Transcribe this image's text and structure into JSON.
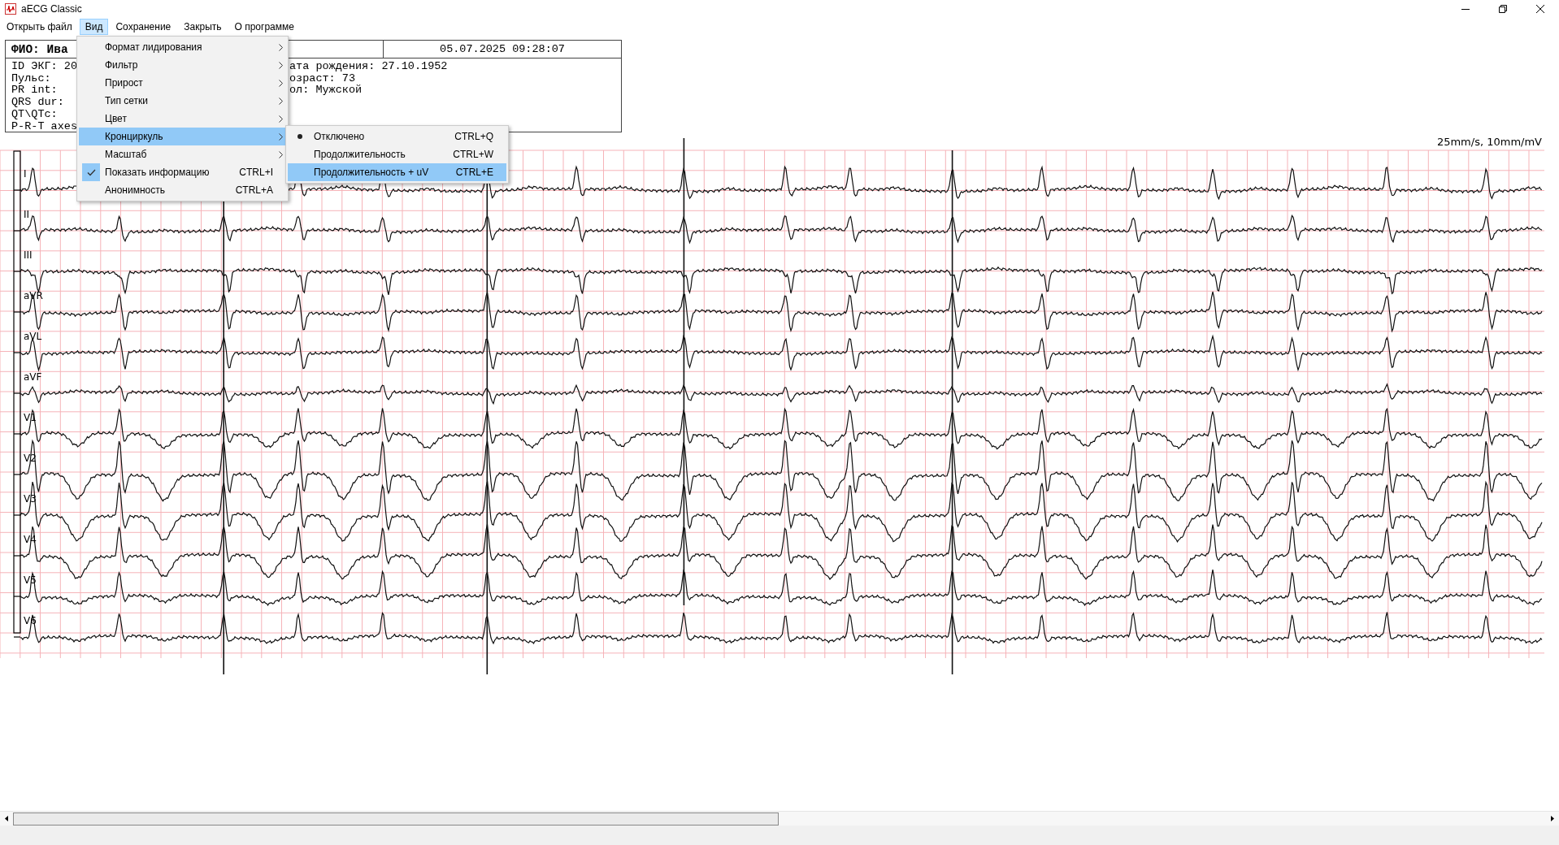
{
  "window": {
    "title": "aECG Classic"
  },
  "menu_bar": [
    {
      "label": "Открыть файл",
      "selected": false
    },
    {
      "label": "Вид",
      "selected": true
    },
    {
      "label": "Сохранение",
      "selected": false
    },
    {
      "label": "Закрыть",
      "selected": false
    },
    {
      "label": "О программе",
      "selected": false
    }
  ],
  "patient_info": {
    "name": "ФИО: Ива",
    "datetime": "05.07.2025 09:28:07",
    "left_lines": [
      "ID ЭКГ: 20",
      "Пульс:",
      "PR int:",
      "QRS dur:",
      "QT\\QTc:",
      "P-R-T axes"
    ],
    "right_lines": [
      "ата рождения: 27.10.1952",
      "озраст: 73",
      "ол: Мужской"
    ]
  },
  "scale_label": "25mm/s, 10mm/mV",
  "leads": [
    {
      "name": "I"
    },
    {
      "name": "II"
    },
    {
      "name": "III"
    },
    {
      "name": "aVR"
    },
    {
      "name": "aVL"
    },
    {
      "name": "aVF"
    },
    {
      "name": "V1"
    },
    {
      "name": "V2"
    },
    {
      "name": "V3"
    },
    {
      "name": "V4"
    },
    {
      "name": "V5"
    },
    {
      "name": "V6"
    }
  ],
  "view_menu": {
    "items": [
      {
        "label": "Формат лидирования",
        "kind": "submenu",
        "highlighted": false
      },
      {
        "label": "Фильтр",
        "kind": "submenu",
        "highlighted": false
      },
      {
        "label": "Прирост",
        "kind": "submenu",
        "highlighted": false
      },
      {
        "label": "Тип сетки",
        "kind": "submenu",
        "highlighted": false
      },
      {
        "label": "Цвет",
        "kind": "submenu",
        "highlighted": false
      },
      {
        "label": "Кронциркуль",
        "kind": "submenu",
        "highlighted": true
      },
      {
        "label": "Масштаб",
        "kind": "submenu",
        "highlighted": false
      },
      {
        "label": "Показать информацию",
        "kind": "toggle",
        "shortcut": "CTRL+I",
        "checked": true,
        "highlighted": false
      },
      {
        "label": "Анонимность",
        "kind": "toggle",
        "shortcut": "CTRL+A",
        "checked": false,
        "highlighted": false
      }
    ]
  },
  "caliper_submenu": {
    "items": [
      {
        "label": "Отключено",
        "shortcut": "CTRL+Q",
        "selected": true,
        "highlighted": false
      },
      {
        "label": "Продолжительность",
        "shortcut": "CTRL+W",
        "selected": false,
        "highlighted": false
      },
      {
        "label": "Продолжительность + uV",
        "shortcut": "CTRL+E",
        "selected": false,
        "highlighted": true
      }
    ]
  }
}
